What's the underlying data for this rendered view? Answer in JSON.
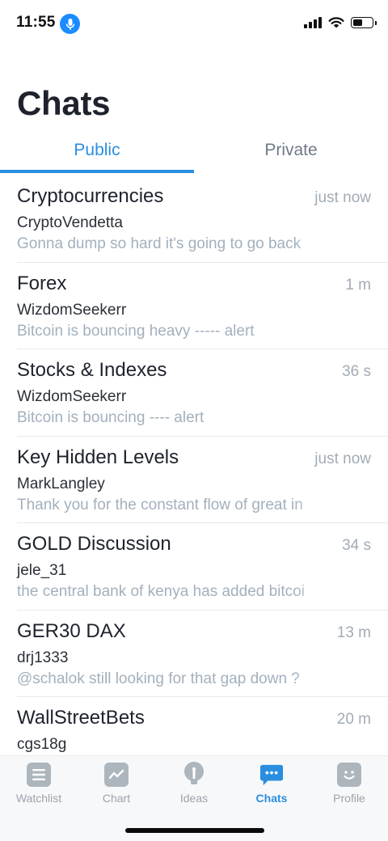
{
  "status_bar": {
    "time": "11:55"
  },
  "page": {
    "title": "Chats"
  },
  "tabs": [
    {
      "label": "Public",
      "active": true
    },
    {
      "label": "Private",
      "active": false
    }
  ],
  "chats": [
    {
      "name": "Cryptocurrencies",
      "time": "just now",
      "user": "CryptoVendetta",
      "message": "Gonna dump so hard it's going to go back"
    },
    {
      "name": "Forex",
      "time": "1 m",
      "user": "WizdomSeekerr",
      "message": "Bitcoin is bouncing heavy ----- alert"
    },
    {
      "name": "Stocks & Indexes",
      "time": "36 s",
      "user": "WizdomSeekerr",
      "message": "Bitcoin is bouncing ---- alert"
    },
    {
      "name": "Key Hidden Levels",
      "time": "just now",
      "user": "MarkLangley",
      "message": "Thank you for the constant flow of great in"
    },
    {
      "name": "GOLD Discussion",
      "time": "34 s",
      "user": "jele_31",
      "message": "the central bank of kenya has added bitcoi"
    },
    {
      "name": "GER30 DAX",
      "time": "13 m",
      "user": "drj1333",
      "message": "@schalok still looking for that gap down ?"
    },
    {
      "name": "WallStreetBets",
      "time": "20 m",
      "user": "cgs18g",
      "message": ""
    }
  ],
  "bottom_nav": [
    {
      "label": "Watchlist",
      "icon": "list-icon",
      "active": false
    },
    {
      "label": "Chart",
      "icon": "chart-icon",
      "active": false
    },
    {
      "label": "Ideas",
      "icon": "lightbulb-icon",
      "active": false
    },
    {
      "label": "Chats",
      "icon": "chat-bubble-icon",
      "active": true
    },
    {
      "label": "Profile",
      "icon": "smiley-icon",
      "active": false
    }
  ],
  "colors": {
    "accent": "#2a8ee0",
    "muted": "#a3b0bd",
    "inactive_icon": "#adb5bd"
  }
}
